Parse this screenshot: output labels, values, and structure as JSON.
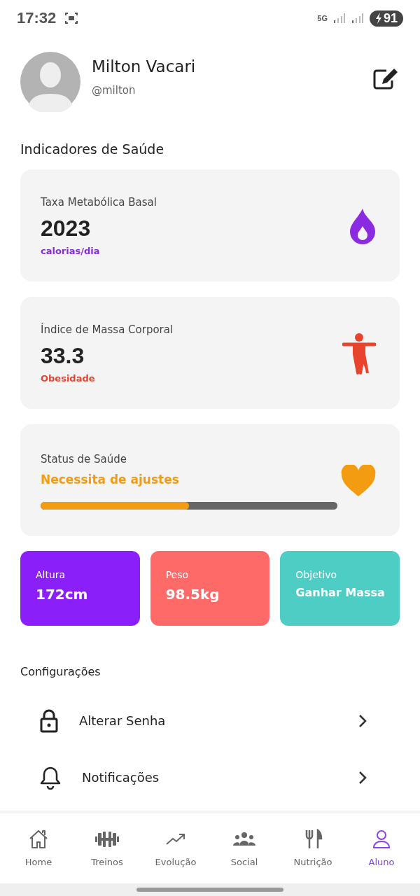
{
  "status_bar": {
    "time": "17:32",
    "network": "5G",
    "battery": "91"
  },
  "profile": {
    "name": "Milton Vacari",
    "handle": "@milton"
  },
  "health": {
    "title": "Indicadores de Saúde",
    "cards": [
      {
        "kind": "flame",
        "label": "Taxa Metabólica Basal",
        "value": "2023",
        "note": "calorias/dia",
        "color": "#8a2be2"
      },
      {
        "kind": "figure",
        "label": "Índice de Massa Corporal",
        "value": "33.3",
        "note": "Obesidade",
        "color": "#e8432d"
      },
      {
        "kind": "heart",
        "label": "Status de Saúde",
        "status": "Necessita de ajustes",
        "color": "#f39c12",
        "level": 0.5
      }
    ]
  },
  "stats": [
    {
      "label": "Altura",
      "value": "172cm",
      "color": "#8b1ffa"
    },
    {
      "label": "Peso",
      "value": "98.5kg",
      "color": "#fe6a67"
    },
    {
      "label": "Objetivo",
      "value": "Ganhar Massa",
      "color": "#4ecdc4"
    }
  ],
  "settings": {
    "title": "Configurações",
    "items": [
      {
        "kind": "lock",
        "label": "Alterar Senha"
      },
      {
        "kind": "bell",
        "label": "Notificações"
      }
    ]
  },
  "nav": [
    {
      "kind": "home",
      "label": "Home",
      "selected": false
    },
    {
      "kind": "dumbbell",
      "label": "Treinos",
      "selected": false
    },
    {
      "kind": "trend",
      "label": "Evolução",
      "selected": false
    },
    {
      "kind": "group",
      "label": "Social",
      "selected": false
    },
    {
      "kind": "food",
      "label": "Nutrição",
      "selected": false
    },
    {
      "kind": "user",
      "label": "Aluno",
      "selected": true
    }
  ]
}
